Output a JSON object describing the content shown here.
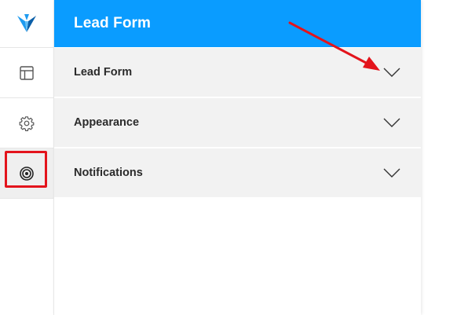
{
  "panel": {
    "title": "Lead Form",
    "sections": [
      {
        "label": "Lead Form",
        "icon": "chevron-down-icon"
      },
      {
        "label": "Appearance",
        "icon": "chevron-down-icon"
      },
      {
        "label": "Notifications",
        "icon": "chevron-down-icon"
      }
    ]
  },
  "rail": {
    "items": [
      {
        "icon": "layout-icon"
      },
      {
        "icon": "gear-icon"
      },
      {
        "icon": "target-icon",
        "active": true
      }
    ]
  },
  "colors": {
    "header": "#0a9cff",
    "row_bg": "#f2f2f2",
    "annotation": "#e3141c"
  }
}
